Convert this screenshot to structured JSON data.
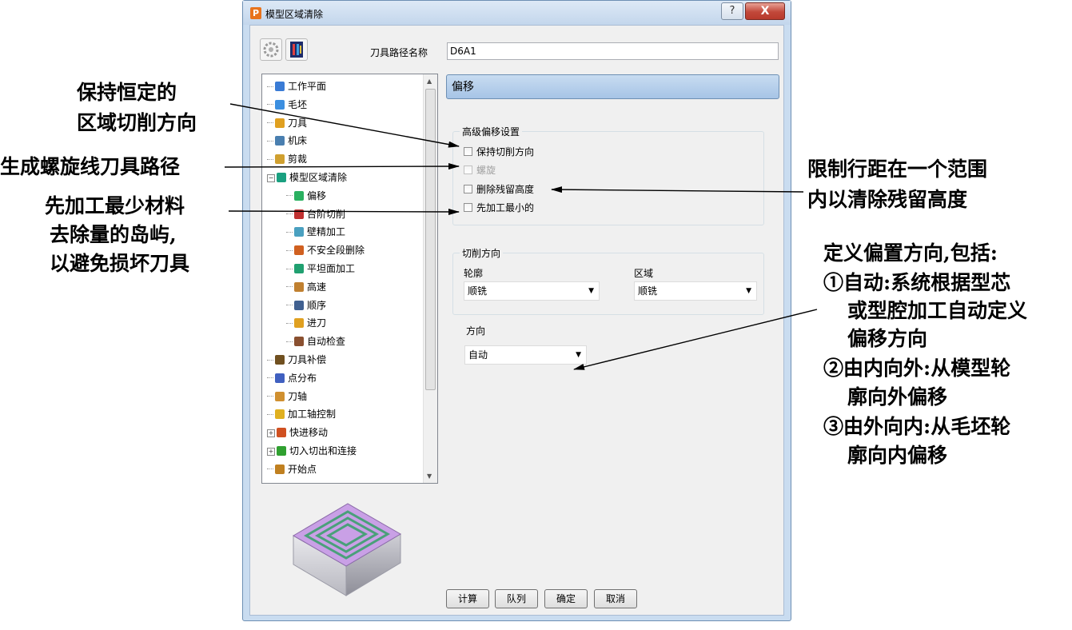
{
  "window": {
    "title": "模型区域清除",
    "app_icon": "P",
    "help_glyph": "?",
    "close_glyph": "X"
  },
  "toolbar": {
    "toolpath_name_label": "刀具路径名称",
    "toolpath_name_value": "D6A1"
  },
  "tree": {
    "items": [
      {
        "label": "工作平面",
        "icon": "workplane-icon",
        "color": "#3a7bd5",
        "indent": 0
      },
      {
        "label": "毛坯",
        "icon": "block-icon",
        "color": "#3c8fe0",
        "indent": 0
      },
      {
        "label": "刀具",
        "icon": "tool-icon",
        "color": "#e0a020",
        "indent": 0
      },
      {
        "label": "机床",
        "icon": "machine-icon",
        "color": "#4a7fb0",
        "indent": 0
      },
      {
        "label": "剪裁",
        "icon": "limit-icon",
        "color": "#d0a030",
        "indent": 0
      },
      {
        "label": "模型区域清除",
        "icon": "area-clear-icon",
        "color": "#1aa080",
        "indent": 0,
        "expander": "−"
      },
      {
        "label": "偏移",
        "icon": "offset-icon",
        "color": "#2ab060",
        "indent": 1
      },
      {
        "label": "台阶切削",
        "icon": "step-cut-icon",
        "color": "#c03030",
        "indent": 1
      },
      {
        "label": "壁精加工",
        "icon": "wall-finish-icon",
        "color": "#4aa0c0",
        "indent": 1
      },
      {
        "label": "不安全段删除",
        "icon": "unsafe-removal-icon",
        "color": "#d06020",
        "indent": 1
      },
      {
        "label": "平坦面加工",
        "icon": "flat-machining-icon",
        "color": "#20a070",
        "indent": 1
      },
      {
        "label": "高速",
        "icon": "high-speed-icon",
        "color": "#c08030",
        "indent": 1
      },
      {
        "label": "顺序",
        "icon": "order-icon",
        "color": "#406090",
        "indent": 1
      },
      {
        "label": "进刀",
        "icon": "plunge-icon",
        "color": "#e0a020",
        "indent": 1
      },
      {
        "label": "自动检查",
        "icon": "auto-verify-icon",
        "color": "#8a5030",
        "indent": 1
      },
      {
        "label": "刀具补偿",
        "icon": "tool-comp-icon",
        "color": "#705020",
        "indent": 0
      },
      {
        "label": "点分布",
        "icon": "point-dist-icon",
        "color": "#4060c0",
        "indent": 0
      },
      {
        "label": "刀轴",
        "icon": "tool-axis-icon",
        "color": "#d09030",
        "indent": 0
      },
      {
        "label": "加工轴控制",
        "icon": "axis-control-icon",
        "color": "#e0b020",
        "indent": 0
      },
      {
        "label": "快进移动",
        "icon": "rapid-move-icon",
        "color": "#d05020",
        "indent": 0,
        "expander": "+"
      },
      {
        "label": "切入切出和连接",
        "icon": "leads-links-icon",
        "color": "#30a030",
        "indent": 0,
        "expander": "+"
      },
      {
        "label": "开始点",
        "icon": "start-point-icon",
        "color": "#c08020",
        "indent": 0
      }
    ]
  },
  "section": {
    "title": "偏移"
  },
  "advanced_offset": {
    "title": "高级偏移设置",
    "options": [
      {
        "label": "保持切削方向",
        "checked": false,
        "enabled": true
      },
      {
        "label": "螺旋",
        "checked": false,
        "enabled": false
      },
      {
        "label": "删除残留高度",
        "checked": false,
        "enabled": true
      },
      {
        "label": "先加工最小的",
        "checked": false,
        "enabled": true
      }
    ]
  },
  "cut_direction": {
    "title": "切削方向",
    "profile_label": "轮廓",
    "profile_value": "顺铣",
    "area_label": "区域",
    "area_value": "顺铣"
  },
  "direction": {
    "label": "方向",
    "value": "自动"
  },
  "buttons": {
    "calculate": "计算",
    "queue": "队列",
    "accept": "确定",
    "cancel": "取消"
  },
  "annotations": {
    "keep_direction": [
      "保持恒定的",
      "区域切削方向"
    ],
    "spiral": "生成螺旋线刀具路径",
    "smallest_first": [
      "先加工最少材料",
      "去除量的岛屿,",
      "以避免损坏刀具"
    ],
    "remove_cusps": [
      "限制行距在一个范围",
      "内以清除残留高度"
    ],
    "direction_help": [
      "定义偏置方向,包括:",
      "①自动:系统根据型芯",
      "或型腔加工自动定义",
      "偏移方向",
      "②由内向外:从模型轮",
      "廓向外偏移",
      "③由外向内:从毛坯轮",
      "廓向内偏移"
    ]
  },
  "colors": {
    "title_bar": "#c9dcf0",
    "section_header": "#b4cfe9",
    "close_button": "#c2483a",
    "preview_top": "#c9a0e6"
  }
}
